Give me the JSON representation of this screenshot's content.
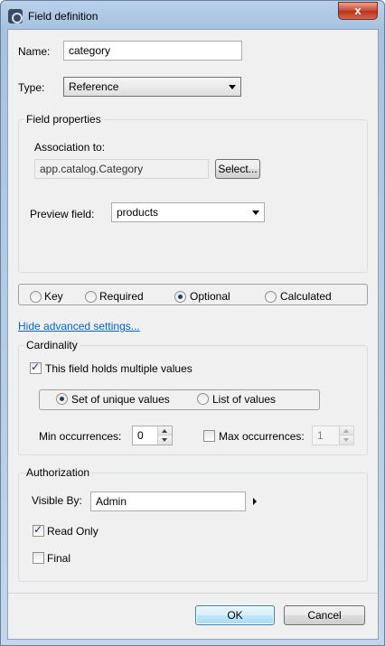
{
  "window": {
    "title": "Field definition",
    "close_label": "x"
  },
  "name": {
    "label": "Name:",
    "value": "category"
  },
  "type": {
    "label": "Type:",
    "value": "Reference"
  },
  "field_properties": {
    "title": "Field properties",
    "association_label": "Association to:",
    "association_value": "app.catalog.Category",
    "select_button": "Select...",
    "preview_label": "Preview field:",
    "preview_value": "products"
  },
  "kind": {
    "options": [
      "Key",
      "Required",
      "Optional",
      "Calculated"
    ],
    "selected": "Optional"
  },
  "advanced_link": "Hide advanced settings...",
  "cardinality": {
    "title": "Cardinality",
    "multiple_label": "This field holds multiple values",
    "multiple_checked": true,
    "set_label": "Set of unique values",
    "list_label": "List of values",
    "collection": "set",
    "min_label": "Min occurrences:",
    "min_value": "0",
    "max_label": "Max occurrences:",
    "max_checked": false,
    "max_value": "1"
  },
  "authorization": {
    "title": "Authorization",
    "visible_label": "Visible By:",
    "visible_value": "Admin",
    "readonly_label": "Read Only",
    "readonly_checked": true,
    "final_label": "Final",
    "final_checked": false
  },
  "buttons": {
    "ok": "OK",
    "cancel": "Cancel"
  }
}
